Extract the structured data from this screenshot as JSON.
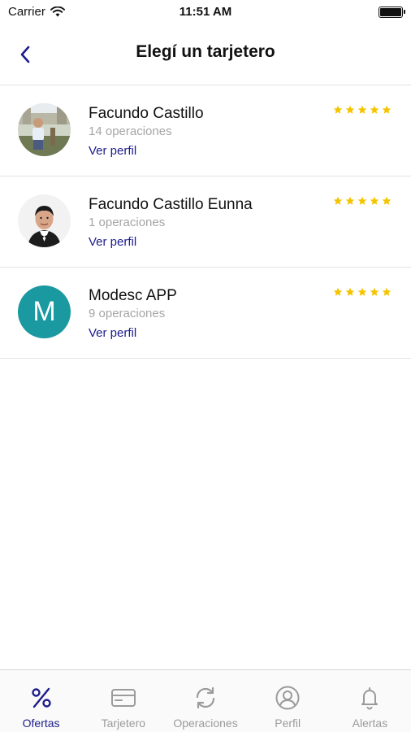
{
  "status_bar": {
    "carrier": "Carrier",
    "time": "11:51 AM",
    "wifi_icon": "wifi-icon",
    "battery_icon": "battery-icon"
  },
  "nav": {
    "title": "Elegí un tarjetero",
    "back_icon": "chevron-left-icon"
  },
  "accent_color": "#1c1c8c",
  "star_color": "#f5c400",
  "cardholders": [
    {
      "name": "Facundo Castillo",
      "operations": "14 operaciones",
      "link": "Ver perfil",
      "rating": 5,
      "avatar": "photo"
    },
    {
      "name": "Facundo Castillo Eunna",
      "operations": "1 operaciones",
      "link": "Ver perfil",
      "rating": 5,
      "avatar": "photo"
    },
    {
      "name": "Modesc APP",
      "operations": "9 operaciones",
      "link": "Ver perfil",
      "rating": 5,
      "avatar_letter": "M",
      "avatar_color": "#1a9aa0"
    }
  ],
  "tabs": [
    {
      "label": "Ofertas",
      "icon": "percent-icon",
      "active": true
    },
    {
      "label": "Tarjetero",
      "icon": "card-icon",
      "active": false
    },
    {
      "label": "Operaciones",
      "icon": "refresh-icon",
      "active": false
    },
    {
      "label": "Perfil",
      "icon": "user-circle-icon",
      "active": false
    },
    {
      "label": "Alertas",
      "icon": "bell-icon",
      "active": false
    }
  ]
}
